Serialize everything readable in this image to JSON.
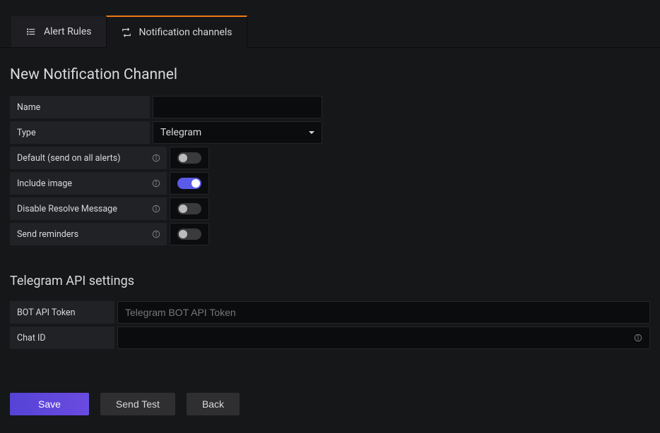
{
  "tabs": {
    "alert_rules": "Alert Rules",
    "notification_channels": "Notification channels"
  },
  "section1_title": "New Notification Channel",
  "form": {
    "name_label": "Name",
    "name_value": "",
    "type_label": "Type",
    "type_value": "Telegram",
    "default_label": "Default (send on all alerts)",
    "include_image_label": "Include image",
    "disable_resolve_label": "Disable Resolve Message",
    "send_reminders_label": "Send reminders",
    "toggles": {
      "default": false,
      "include_image": true,
      "disable_resolve": false,
      "send_reminders": false
    }
  },
  "api": {
    "title": "Telegram API settings",
    "bot_token_label": "BOT API Token",
    "bot_token_placeholder": "Telegram BOT API Token",
    "bot_token_value": "",
    "chat_id_label": "Chat ID",
    "chat_id_value": ""
  },
  "buttons": {
    "save": "Save",
    "send_test": "Send Test",
    "back": "Back"
  }
}
